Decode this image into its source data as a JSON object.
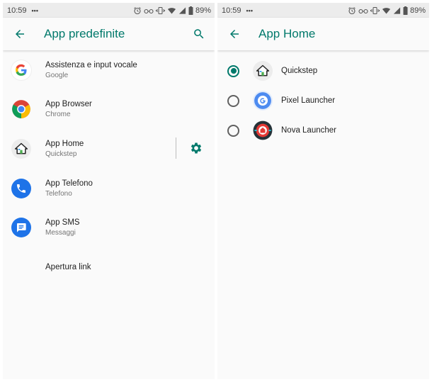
{
  "left": {
    "status": {
      "time": "10:59",
      "dots": "•••",
      "battery": "89%"
    },
    "app_bar": {
      "title": "App predefinite"
    },
    "items": [
      {
        "primary": "Assistenza e input vocale",
        "secondary": "Google",
        "icon": "google-icon"
      },
      {
        "primary": "App Browser",
        "secondary": "Chrome",
        "icon": "chrome-icon"
      },
      {
        "primary": "App Home",
        "secondary": "Quickstep",
        "icon": "quickstep-icon"
      },
      {
        "primary": "App Telefono",
        "secondary": "Telefono",
        "icon": "phone-icon"
      },
      {
        "primary": "App SMS",
        "secondary": "Messaggi",
        "icon": "messages-icon"
      },
      {
        "primary": "Apertura link",
        "secondary": ""
      }
    ]
  },
  "right": {
    "status": {
      "time": "10:59",
      "dots": "•••",
      "battery": "89%"
    },
    "app_bar": {
      "title": "App Home"
    },
    "options": [
      {
        "label": "Quickstep",
        "selected": true,
        "icon": "quickstep-icon"
      },
      {
        "label": "Pixel Launcher",
        "selected": false,
        "icon": "pixel-launcher-icon"
      },
      {
        "label": "Nova Launcher",
        "selected": false,
        "icon": "nova-launcher-icon"
      }
    ]
  },
  "colors": {
    "accent": "#00796b",
    "status_bar": "#ececec",
    "background": "#fafafa"
  }
}
